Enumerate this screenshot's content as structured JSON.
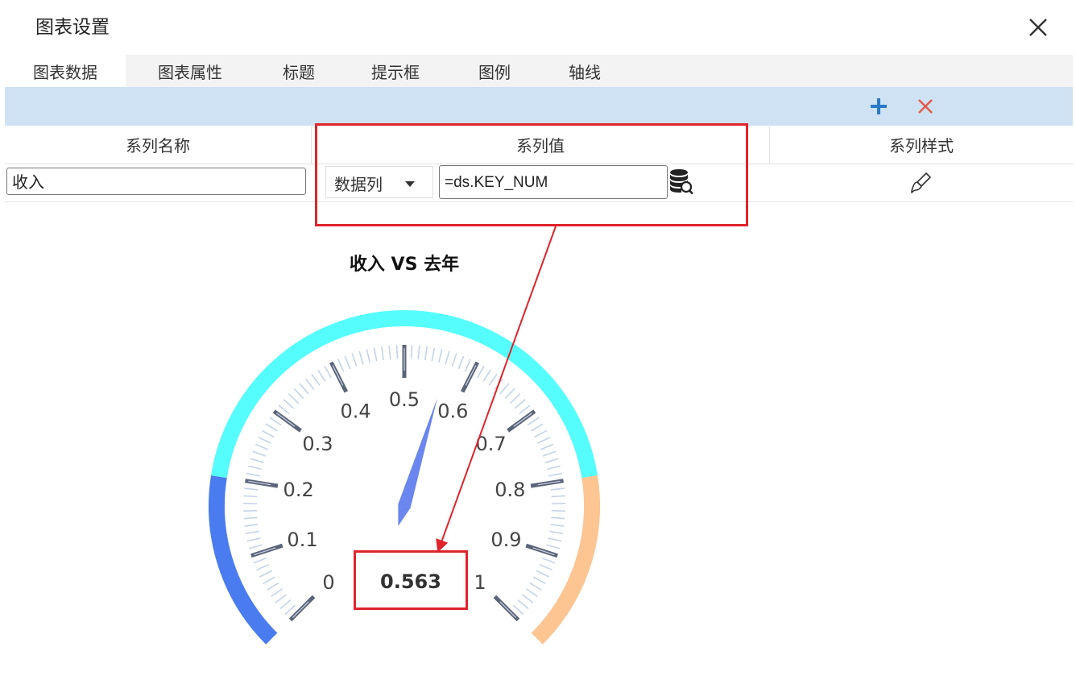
{
  "dialog": {
    "title": "图表设置",
    "close_icon": "close-icon"
  },
  "tabs": [
    {
      "label": "图表数据",
      "active": true
    },
    {
      "label": "图表属性",
      "active": false
    },
    {
      "label": "标题",
      "active": false
    },
    {
      "label": "提示框",
      "active": false
    },
    {
      "label": "图例",
      "active": false
    },
    {
      "label": "轴线",
      "active": false
    }
  ],
  "toolbar": {
    "add_icon": "plus-icon",
    "add_color": "#2a7ac8",
    "delete_icon": "cross-icon",
    "delete_color": "#e05a4a"
  },
  "table": {
    "headers": {
      "name": "系列名称",
      "value": "系列值",
      "style": "系列样式"
    },
    "row": {
      "name": "收入",
      "value_type": "数据列",
      "value_expr": "=ds.KEY_NUM",
      "db_icon": "database-search-icon",
      "style_icon": "brush-icon"
    }
  },
  "colors": {
    "highlight": "#e0242c",
    "toolbar_bg": "#cfe2f3",
    "pointer": "#6b86ee"
  },
  "chart_data": {
    "type": "gauge",
    "title": "收入 VS 去年",
    "min": 0,
    "max": 1,
    "value": 0.563,
    "value_label": "0.563",
    "tick_labels": [
      "0",
      "0.1",
      "0.2",
      "0.3",
      "0.4",
      "0.5",
      "0.6",
      "0.7",
      "0.8",
      "0.9",
      "1"
    ],
    "bands": [
      {
        "from": 0,
        "to": 0.2,
        "color": "#4a7cf0"
      },
      {
        "from": 0.2,
        "to": 0.8,
        "color": "#55fdfd"
      },
      {
        "from": 0.8,
        "to": 1,
        "color": "#fcc592"
      }
    ]
  }
}
